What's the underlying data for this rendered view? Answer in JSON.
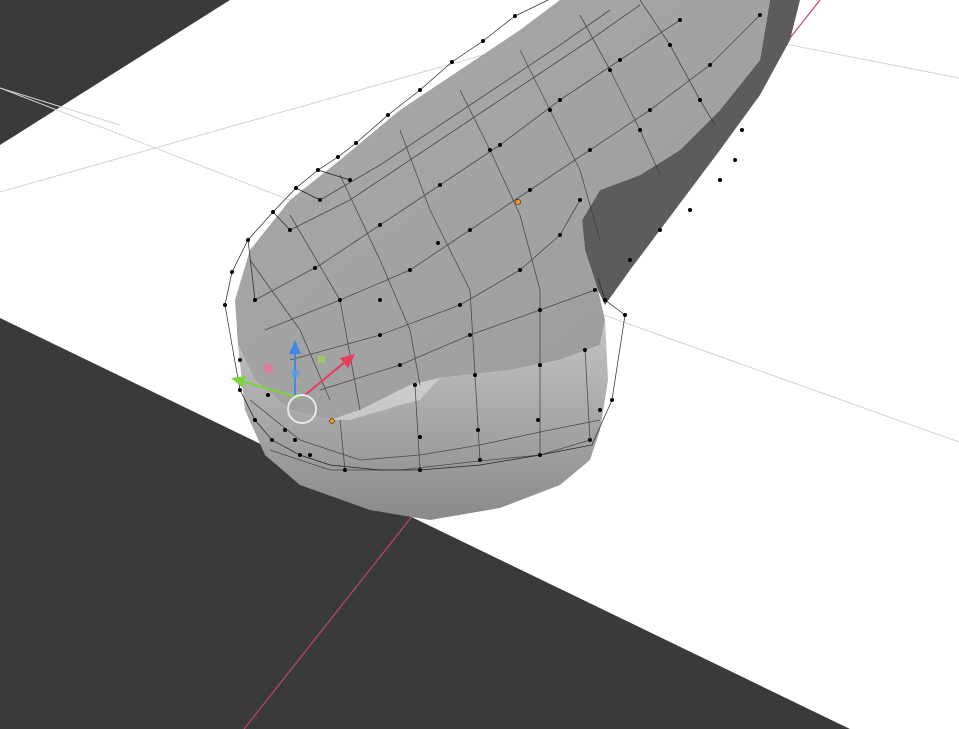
{
  "viewport": {
    "mode": "edit-mode",
    "object": "curved-mesh-with-subdivision-cage"
  },
  "colors": {
    "background_dark": "#3a3a3a",
    "ground_plane": "#ffffff",
    "grid_line": "#cfcfcf",
    "x_axis": "#c0485a",
    "mesh_light": "#b4b4b4",
    "mesh_mid": "#9c9c9c",
    "mesh_dark": "#5e5e5e",
    "vertex": "#000000",
    "selected_vertex": "#f09a1a",
    "gizmo_x": "#e83a5a",
    "gizmo_y": "#7cd23a",
    "gizmo_z": "#3f8ae8",
    "pivot_circle": "#e8e8e8"
  },
  "icons": {
    "gizmo": "transform-gizmo-icon",
    "pivot": "pivot-circle-icon"
  }
}
